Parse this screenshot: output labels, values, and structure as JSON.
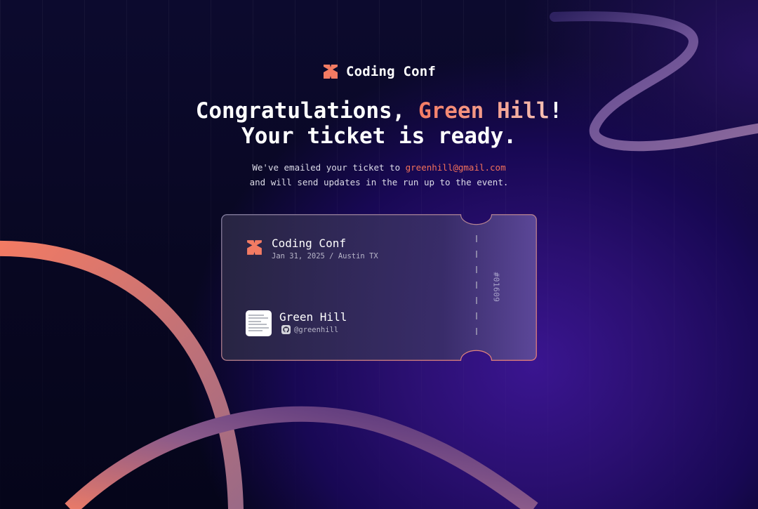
{
  "brand": {
    "name": "Coding Conf",
    "logo_icon": "coding-conf-logo-icon",
    "accent_color": "#f37b63"
  },
  "headline": {
    "line1_prefix": "Congratulations, ",
    "attendee_name": "Green Hill",
    "line1_suffix": "!",
    "line2": "Your ticket is ready."
  },
  "subtext": {
    "prefix": "We've emailed your ticket to ",
    "email": "greenhill@gmail.com",
    "line2": "and will send updates in the run up to the event."
  },
  "ticket": {
    "event_name": "Coding Conf",
    "event_meta": "Jan 31, 2025 / Austin TX",
    "attendee_name": "Green Hill",
    "github_icon": "github-icon",
    "github_handle": "@greenhill",
    "ticket_number": "#01609"
  },
  "colors": {
    "background": "#0c0a2e",
    "accent": "#f37b63",
    "email": "#f3715a",
    "ticket_border": "#e0837a"
  }
}
